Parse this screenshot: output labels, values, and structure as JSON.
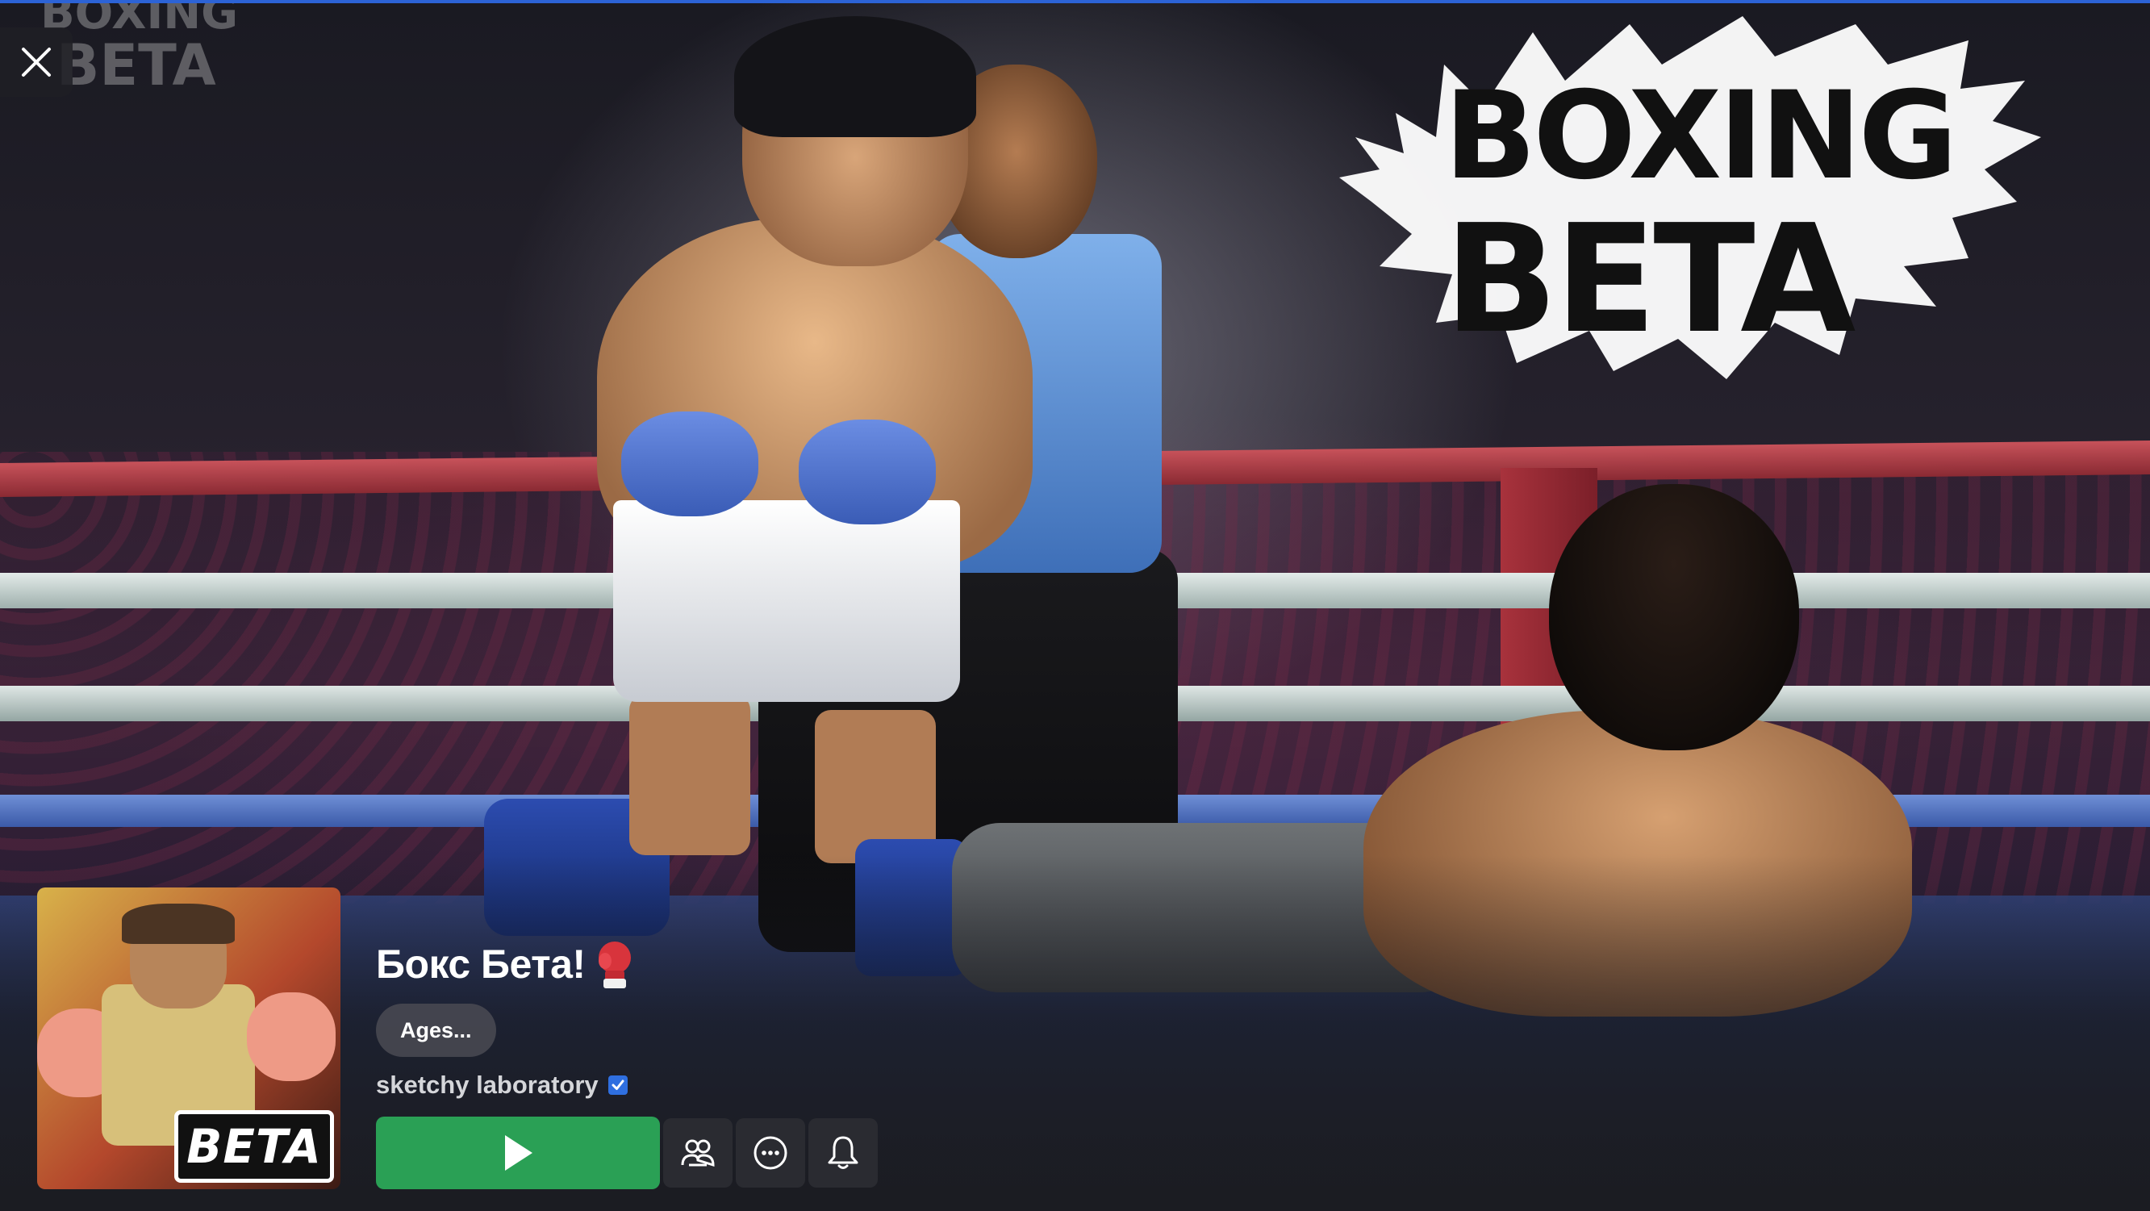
{
  "game": {
    "title": "Бокс Бета!",
    "title_emoji_icon": "boxing-glove-icon",
    "age_rating": "Ages...",
    "creator": "sketchy laboratory",
    "creator_verified": true,
    "thumbnail_badge": "BETA",
    "hero_logo_text": [
      "BOXING",
      "BETA"
    ]
  },
  "actions": {
    "play_icon": "play-icon",
    "party_icon": "party-icon",
    "more_icon": "more-icon",
    "notify_icon": "bell-icon",
    "close_icon": "close-icon"
  },
  "colors": {
    "play_button": "#2aa055",
    "top_accent": "#2c63d6",
    "verified_badge": "#2f6fe0",
    "page_background": "#1b1c21"
  }
}
